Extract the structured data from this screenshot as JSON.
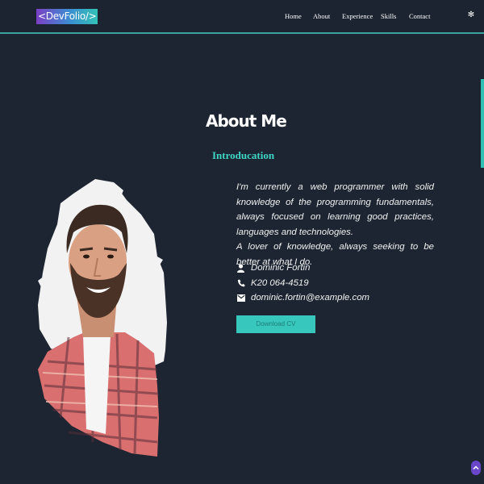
{
  "header": {
    "logo": "<DevFolio/>",
    "nav": [
      "Home",
      "About",
      "Experience",
      "Skills",
      "Contact"
    ],
    "theme_icon": "sun-icon"
  },
  "about": {
    "title": "About Me",
    "subtitle": "Introducation",
    "bio_paragraphs": [
      "I'm currently a web programmer with solid knowledge of the programming fundamentals, always focused on learning good practices, languages and technologies.",
      "A lover of knowledge, always seeking to be better at what I do."
    ],
    "name": "Dominic  Fortin",
    "phone": "K20 064-4519",
    "email": "dominic.fortin@example.com",
    "cv_button": "Download CV"
  },
  "colors": {
    "background": "#1c2531",
    "accent": "#37c7bd",
    "subtitle": "#3fd6c6",
    "scroll_top": "#6a47c9"
  },
  "icons": {
    "name": "person-icon",
    "phone": "phone-icon",
    "email": "mail-icon",
    "scroll_top": "arrow-up-icon"
  }
}
